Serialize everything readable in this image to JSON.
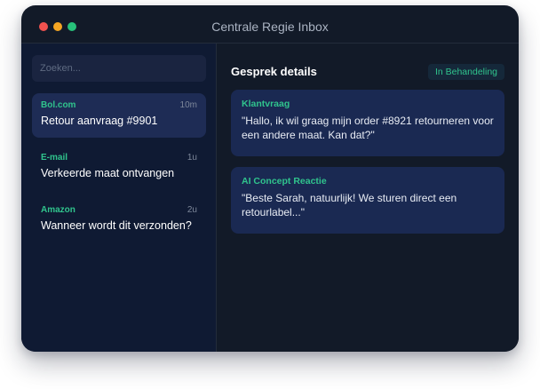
{
  "window": {
    "title": "Centrale Regie Inbox"
  },
  "sidebar": {
    "search_placeholder": "Zoeken...",
    "conversations": [
      {
        "source": "Bol.com",
        "time": "10m",
        "subject": "Retour aanvraag #9901",
        "active": true
      },
      {
        "source": "E-mail",
        "time": "1u",
        "subject": "Verkeerde maat ontvangen",
        "active": false
      },
      {
        "source": "Amazon",
        "time": "2u",
        "subject": "Wanneer wordt dit verzonden?",
        "active": false
      }
    ]
  },
  "detail": {
    "title": "Gesprek details",
    "status": "In Behandeling",
    "messages": [
      {
        "label": "Klantvraag",
        "text": "\"Hallo, ik wil graag mijn order #8921 retourneren voor een andere maat. Kan dat?\""
      },
      {
        "label": "AI Concept Reactie",
        "text": "\"Beste Sarah, natuurlijk! We sturen direct een retourlabel...\""
      }
    ]
  },
  "colors": {
    "accent": "#30c48d",
    "window_bg": "#121a28",
    "sidebar_bg": "#0f1a33",
    "card_bg": "#1a2952"
  }
}
